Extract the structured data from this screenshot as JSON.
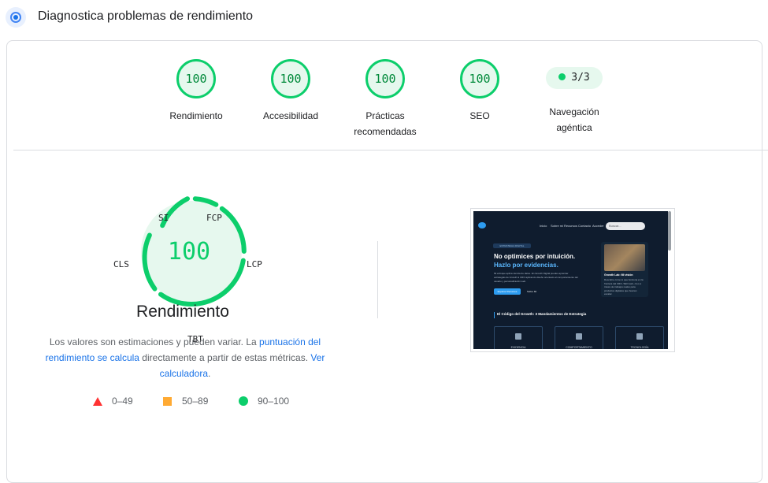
{
  "header": {
    "title": "Diagnostica problemas de rendimiento",
    "icon": "lighthouse-icon"
  },
  "categories": [
    {
      "score": "100",
      "label": "Rendimiento"
    },
    {
      "score": "100",
      "label": "Accesibilidad"
    },
    {
      "score": "100",
      "label": "Prácticas recomendadas"
    },
    {
      "score": "100",
      "label": "SEO"
    },
    {
      "score": "3/3",
      "label": "Navegación agéntica"
    }
  ],
  "performance": {
    "score": "100",
    "title": "Rendimiento",
    "metrics": {
      "si": "SI",
      "fcp": "FCP",
      "lcp": "LCP",
      "tbt": "TBT",
      "cls": "CLS"
    },
    "desc_prefix": "Los valores son estimaciones y pueden variar. La ",
    "desc_link1": "puntuación del rendimiento se calcula",
    "desc_middle": " directamente a partir de estas métricas. ",
    "desc_link2": "Ver calculadora",
    "desc_suffix": "."
  },
  "legend": [
    {
      "range": "0–49",
      "color": "#ff3333"
    },
    {
      "range": "50–89",
      "color": "#ffaa33"
    },
    {
      "range": "90–100",
      "color": "#0cce6b"
    }
  ],
  "screenshot": {
    "nav": [
      "Inicio",
      "Sobre mí",
      "Recursos",
      "Contacto",
      "Acceder"
    ],
    "search_placeholder": "Buscar...",
    "tag": "ESTRATEGIA DIGITAL",
    "headline1": "No optimices por intuición.",
    "headline2": "Hazlo por evidencias.",
    "paragraph": "Mi enfoque aplica ciencia de datos. En Growth Digital puedes aprender estrategias de Growth & CRO aplicando diseño orientado al comportamiento del usuario y personalización web.",
    "cta": "Explorar Recursos",
    "cta_secondary": "Sobre Mí",
    "card_title": "Growth Lab: Mi visión",
    "card_text": "Descubre cómo lo que funciona en la frontera del CRO, SEO web, creo a través de trabajos reales para productos digitales que buscan escalar.",
    "section_title": "El Código del Growth: 3 Mandamientos de Estrategia",
    "boxes": [
      "EVIDENCIA",
      "COMPORTAMIENTO",
      "TECNOLOGÍA"
    ]
  }
}
